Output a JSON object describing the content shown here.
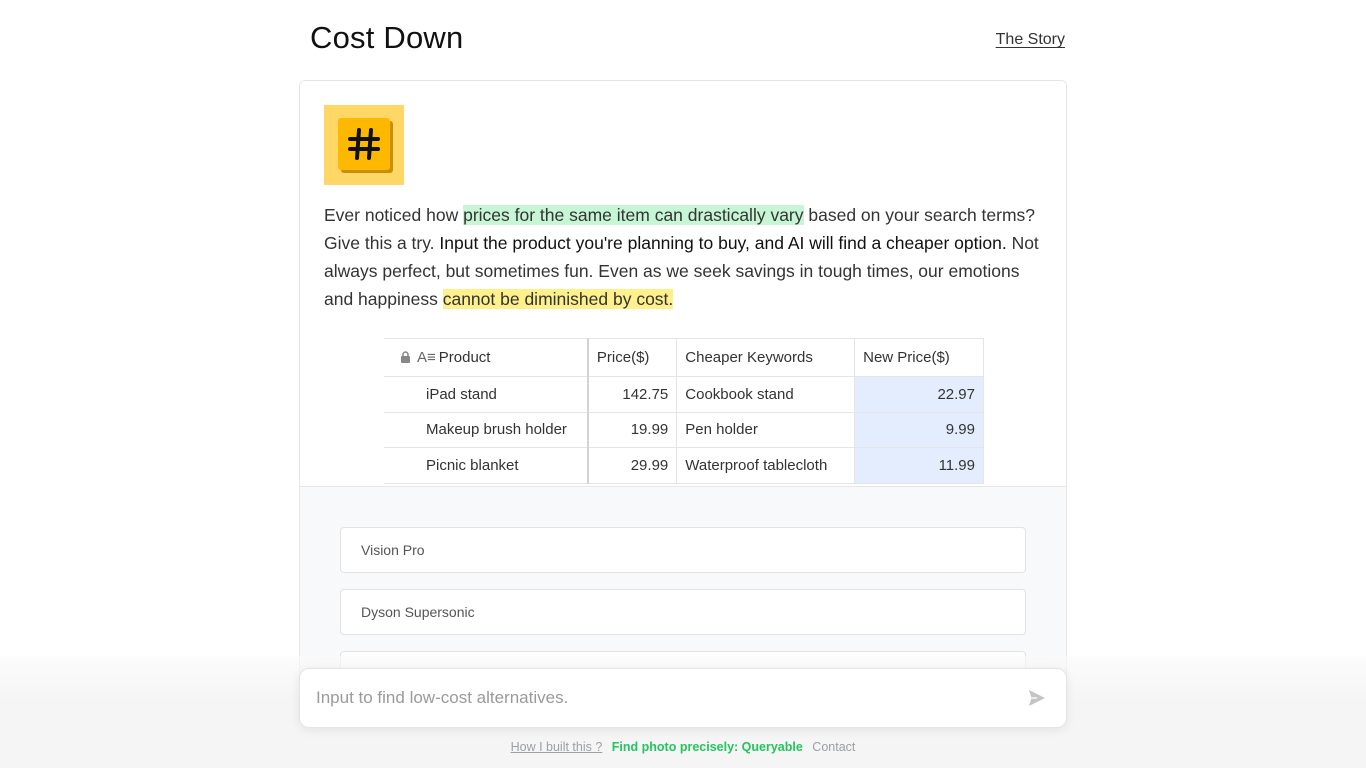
{
  "header": {
    "title": "Cost Down",
    "story_link": "The Story"
  },
  "intro": {
    "p1": "Ever noticed how ",
    "hl1": "prices for the same item can drastically vary",
    "p2": " based on your search terms? Give this a try. ",
    "bold": "Input the product you're planning to buy, and AI will find a cheaper option.",
    "p3": " Not always perfect, but sometimes fun. Even as we seek savings in tough times, our emotions and happiness ",
    "hl2": "cannot be diminished by cost."
  },
  "table": {
    "headers": [
      "Product",
      "Price($)",
      "Cheaper Keywords",
      "New Price($)"
    ],
    "rows": [
      [
        "iPad stand",
        "142.75",
        "Cookbook stand",
        "22.97"
      ],
      [
        "Makeup brush holder",
        "19.99",
        "Pen holder",
        "9.99"
      ],
      [
        "Picnic blanket",
        "29.99",
        "Waterproof tablecloth",
        "11.99"
      ]
    ]
  },
  "suggestions": [
    "Vision Pro",
    "Dyson Supersonic",
    ""
  ],
  "input": {
    "placeholder": "Input to find low-cost alternatives."
  },
  "footer": {
    "built": "How I built this ?",
    "find": "Find photo precisely: Queryable",
    "contact": "Contact"
  },
  "icons": {
    "logo": "hash-key-icon",
    "send": "send-icon",
    "lock": "lock-icon",
    "text_column": "text-column-icon"
  },
  "colors": {
    "highlight_green": "#c6f6d5",
    "highlight_yellow": "#fef08a",
    "new_price_cell": "#e4edfd",
    "footer_link_green": "#22c55e",
    "logo_bg": "#ffd766",
    "logo_key": "#ffb800"
  }
}
